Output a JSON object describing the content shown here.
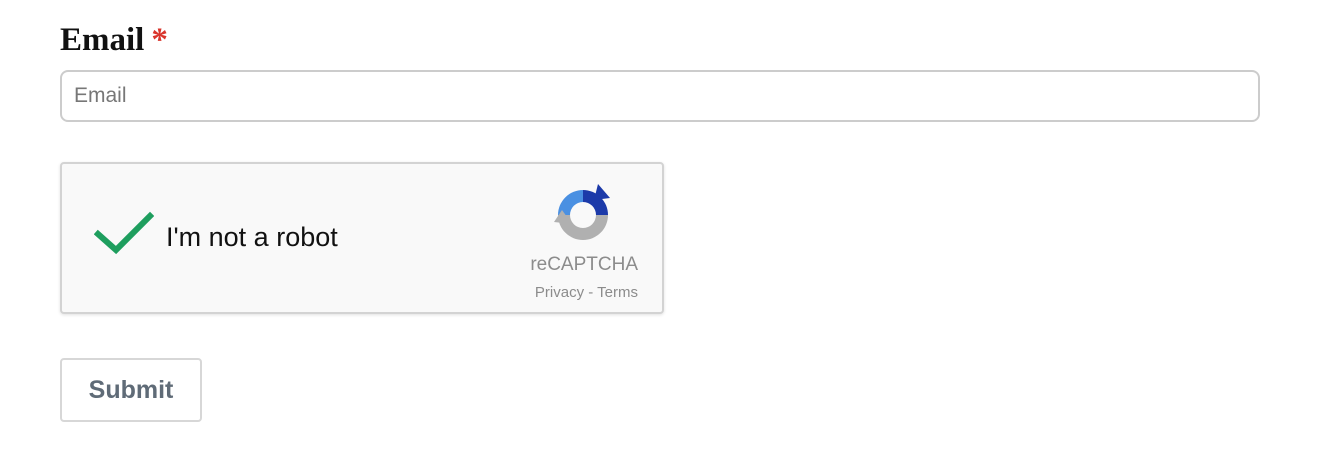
{
  "form": {
    "email_label": "Email",
    "required_mark": "*",
    "email_placeholder": "Email",
    "email_value": ""
  },
  "recaptcha": {
    "checkbox_label": "I'm not a robot",
    "checked": true,
    "brand": "reCAPTCHA",
    "privacy_link": "Privacy",
    "separator": " - ",
    "terms_link": "Terms"
  },
  "submit": {
    "label": "Submit"
  },
  "colors": {
    "check_green": "#1e9e5e",
    "required_red": "#d9342b",
    "logo_blue": "#4a90e2",
    "logo_dark_blue": "#1c3aa9",
    "logo_gray": "#b0b0b0"
  },
  "icons": {
    "check": "check-icon",
    "recaptcha_logo": "recaptcha-logo-icon"
  }
}
